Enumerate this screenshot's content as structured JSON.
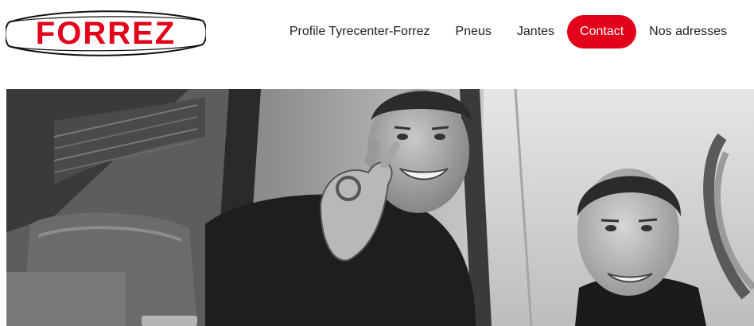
{
  "brand": {
    "name": "FORREZ",
    "color": "#e2001a"
  },
  "nav": {
    "items": [
      {
        "label": "Profile Tyrecenter-Forrez",
        "active": false
      },
      {
        "label": "Pneus",
        "active": false
      },
      {
        "label": "Jantes",
        "active": false
      },
      {
        "label": "Contact",
        "active": true
      },
      {
        "label": "Nos adresses",
        "active": false
      }
    ],
    "active_color": "#e2001a"
  },
  "hero": {
    "image": "black-and-white photo of two smiling men at a van window, one making an OK hand sign"
  }
}
